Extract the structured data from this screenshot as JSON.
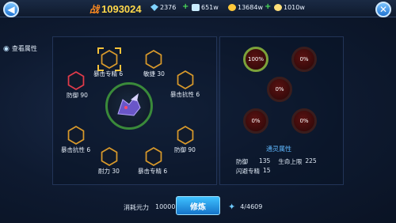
{
  "topbar": {
    "back_icon": "back-arrow-icon",
    "close_icon": "close-icon",
    "power_icon_text": "战",
    "power": "1093024",
    "diamond": "2376",
    "crystal": "651w",
    "gold": "13684w",
    "coin": "1010w"
  },
  "view_attr": "查看属性",
  "nodes": {
    "top": "暴击专精 6",
    "agility": "敏捷 30",
    "defense_left": "防御 90",
    "crit_resist_right": "暴击抗性 6",
    "crit_resist_left": "暴击抗性 6",
    "defense_right": "防御 90",
    "stamina": "耐力 30",
    "crit_mastery_bottom": "暴击专精 6"
  },
  "orbs": {
    "o1": "100%",
    "o2": "0%",
    "o3": "0%",
    "o4": "0%",
    "o5": "0%"
  },
  "spirit": {
    "title": "通灵属性",
    "def_label": "防御",
    "def_val": "135",
    "hp_label": "生命上限",
    "hp_val": "225",
    "dodge_label": "闪避专精",
    "dodge_val": "15"
  },
  "bottom": {
    "cost_label": "消耗元力",
    "cost_val": "10000",
    "train": "修炼",
    "have": "4/4609"
  },
  "colors": {
    "accent": "#2d9be8",
    "gold": "#ffd84a",
    "hex": "#d99a2b"
  }
}
